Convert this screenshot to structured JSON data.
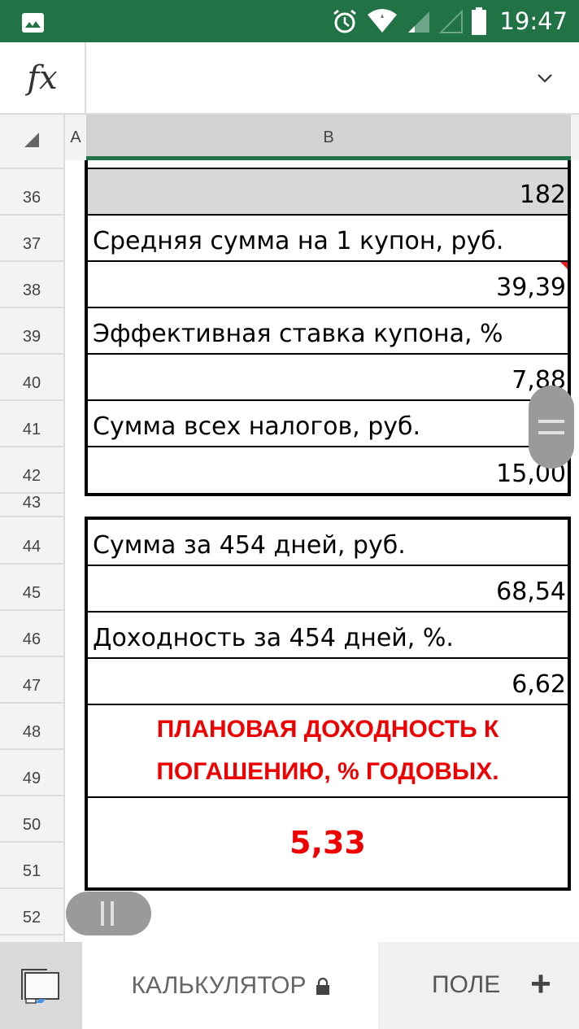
{
  "status_bar": {
    "time": "19:47",
    "icons": [
      "gallery-icon",
      "alarm-icon",
      "wifi-icon",
      "signal-icon",
      "signal-empty-icon",
      "battery-icon"
    ],
    "background": "#217346"
  },
  "formula_bar": {
    "fx_label": "fx",
    "value": ""
  },
  "column_headers": {
    "corner": "",
    "a": "A",
    "b": "B"
  },
  "row_numbers": [
    "36",
    "37",
    "38",
    "39",
    "40",
    "41",
    "42",
    "43",
    "44",
    "45",
    "46",
    "47",
    "48",
    "49",
    "50",
    "51",
    "52"
  ],
  "box1": {
    "rows": [
      {
        "row": "36",
        "value": "182",
        "type": "number",
        "shaded": true
      },
      {
        "row": "37",
        "value": "Средняя сумма на 1 купон, руб.",
        "type": "label"
      },
      {
        "row": "38",
        "value": "39,39",
        "type": "number",
        "comment": true
      },
      {
        "row": "39",
        "value": "Эффективная ставка купона, %",
        "type": "label"
      },
      {
        "row": "40",
        "value": "7,88",
        "type": "number"
      },
      {
        "row": "41",
        "value": "Сумма всех налогов, руб.",
        "type": "label"
      },
      {
        "row": "42",
        "value": "15,00",
        "type": "number"
      }
    ]
  },
  "box2": {
    "rows": [
      {
        "row": "44",
        "value": "Сумма за 454 дней, руб.",
        "type": "label"
      },
      {
        "row": "45",
        "value": "68,54",
        "type": "number"
      },
      {
        "row": "46",
        "value": "Доходность за 454 дней, %.",
        "type": "label"
      },
      {
        "row": "47",
        "value": "6,62",
        "type": "number"
      },
      {
        "row": "48-49",
        "value": "ПЛАНОВАЯ ДОХОДНОСТЬ К ПОГАШЕНИЮ, % ГОДОВЫХ.",
        "type": "heading"
      },
      {
        "row": "50-51",
        "value": "5,33",
        "type": "result"
      }
    ],
    "accent_color": "#ee0000"
  },
  "sheet_tabs": {
    "active": "КАЛЬКУЛЯТОР",
    "active_locked": true,
    "next": "ПОЛЕ",
    "add_label": "+"
  }
}
